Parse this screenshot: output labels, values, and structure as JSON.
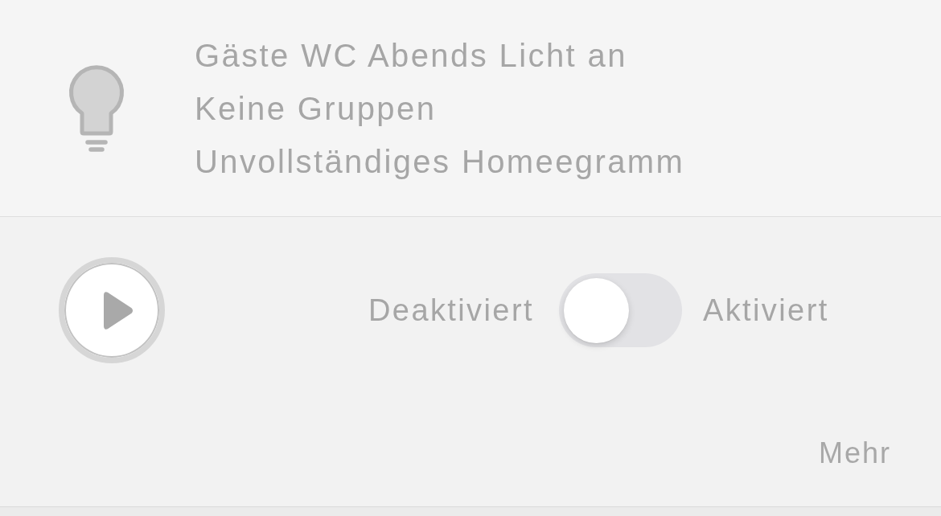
{
  "rule": {
    "title": "Gäste WC Abends Licht an",
    "groups": "Keine Gruppen",
    "status": "Unvollständiges Homeegramm"
  },
  "controls": {
    "toggle": {
      "off_label": "Deaktiviert",
      "on_label": "Aktiviert",
      "on": false
    }
  },
  "more_link": "Mehr"
}
